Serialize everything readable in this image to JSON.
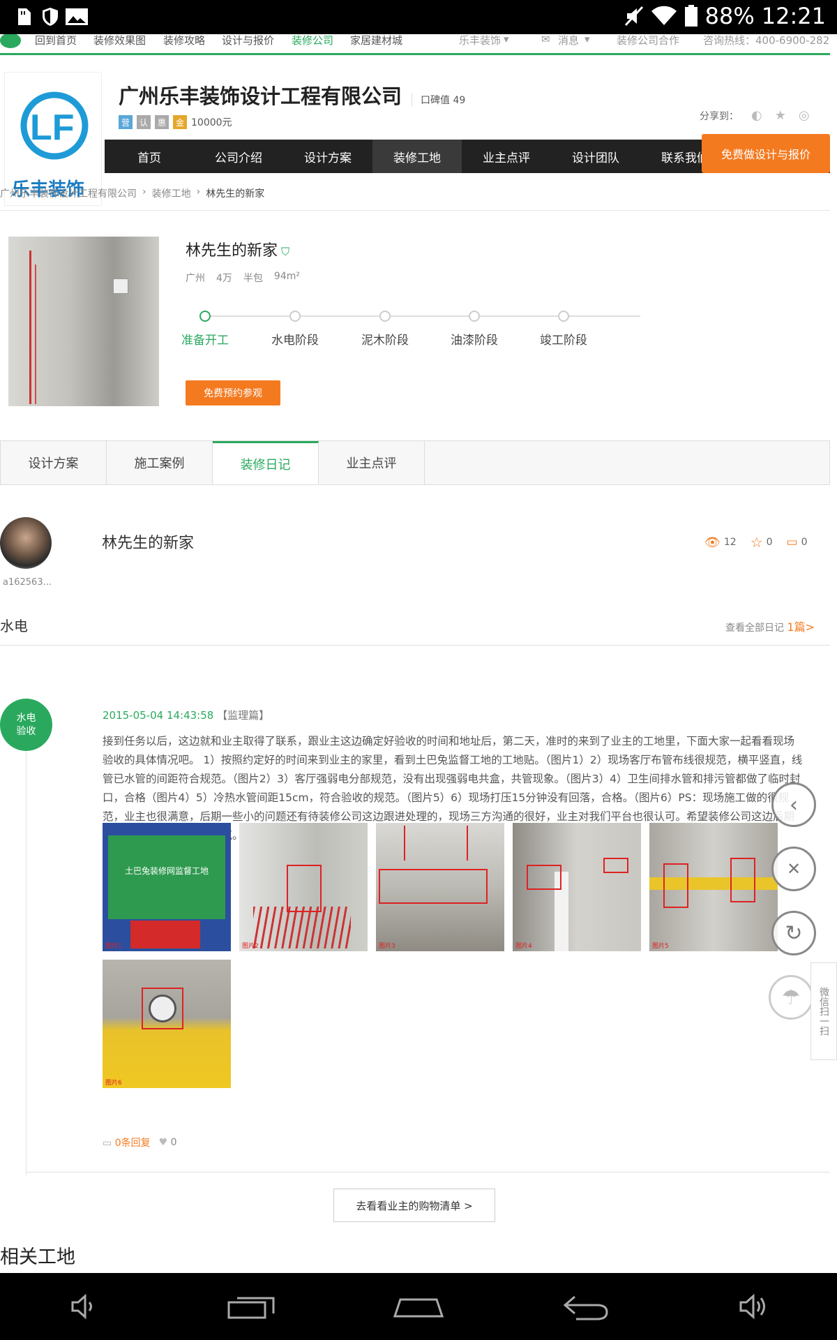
{
  "status_bar": {
    "battery": "88%",
    "time": "12:21"
  },
  "top_nav": {
    "items": [
      "回到首页",
      "装修效果图",
      "装修攻略",
      "设计与报价",
      "装修公司",
      "家居建材城"
    ],
    "user": "乐丰装饰",
    "messages": "消息",
    "partner": "装修公司合作",
    "hotline": "咨询热线：400-6900-282"
  },
  "company": {
    "logo_text": "乐丰装饰",
    "name": "广州乐丰装饰设计工程有限公司",
    "koubei": "口碑值 49",
    "badges": [
      "营",
      "认",
      "惠",
      "金"
    ],
    "deposit": "10000元",
    "share_label": "分享到："
  },
  "main_nav": {
    "items": [
      "首页",
      "公司介绍",
      "设计方案",
      "装修工地",
      "业主点评",
      "设计团队",
      "联系我们"
    ],
    "active_index": 3,
    "free_button": "免费做设计与报价"
  },
  "breadcrumb": [
    "广州乐丰装饰设计工程有限公司",
    "装修工地",
    "林先生的新家"
  ],
  "project": {
    "title": "林先生的新家",
    "city": "广州",
    "budget": "4万",
    "package": "半包",
    "area": "94m²",
    "stages": [
      "准备开工",
      "水电阶段",
      "泥木阶段",
      "油漆阶段",
      "竣工阶段"
    ],
    "active_stage": 0,
    "visit_button": "免费预约参观"
  },
  "tabs": {
    "items": [
      "设计方案",
      "施工案例",
      "装修日记",
      "业主点评"
    ],
    "active_index": 2
  },
  "diary": {
    "username": "a162563...",
    "title": "林先生的新家",
    "views": "12",
    "favorites": "0",
    "comments": "0"
  },
  "section": {
    "title": "水电",
    "view_all": "查看全部日记",
    "count": "1篇>"
  },
  "entry": {
    "badge_line1": "水电",
    "badge_line2": "验收",
    "date": "2015-05-04 14:43:58",
    "tag": "【监理篇】",
    "text": "接到任务以后，这边就和业主取得了联系，跟业主这边确定好验收的时间和地址后，第二天，准时的来到了业主的工地里，下面大家一起看看现场验收的具体情况吧。 1）按照约定好的时间来到业主的家里，看到土巴兔监督工地的工地贴。（图片1）2）现场客厅布管布线很规范，横平竖直，线管已水管的间距符合规范。（图片2）3）客厅强弱电分部规范，没有出现强弱电共盒，共管现象。（图片3）4）卫生间排水管和排污管都做了临时封口，合格（图片4）5）冷热水管间距15cm，符合验收的规范。（图片5）6）现场打压15分钟没有回落，合格。（图片6）PS：现场施工做的很规范，业主也很满意，后期一些小的问题还有待装修公司这边跟进处理的，现场三方沟通的很好，业主对我们平台也很认可。希望装修公司这边后期继续努力，后期节点做规范。",
    "photo_labels": [
      "图片1",
      "图片2",
      "图片3",
      "图片4",
      "图片5",
      "图片6"
    ],
    "poster_text": "土巴兔装修网监督工地",
    "replies": "0条回复",
    "likes": "0"
  },
  "shopping_button": "去看看业主的购物清单 >",
  "related_title": "相关工地",
  "wechat": "微信扫一扫",
  "colors": {
    "brand_green": "#2aa95e",
    "accent_orange": "#f47a20",
    "logo_blue": "#1e9bd7"
  }
}
